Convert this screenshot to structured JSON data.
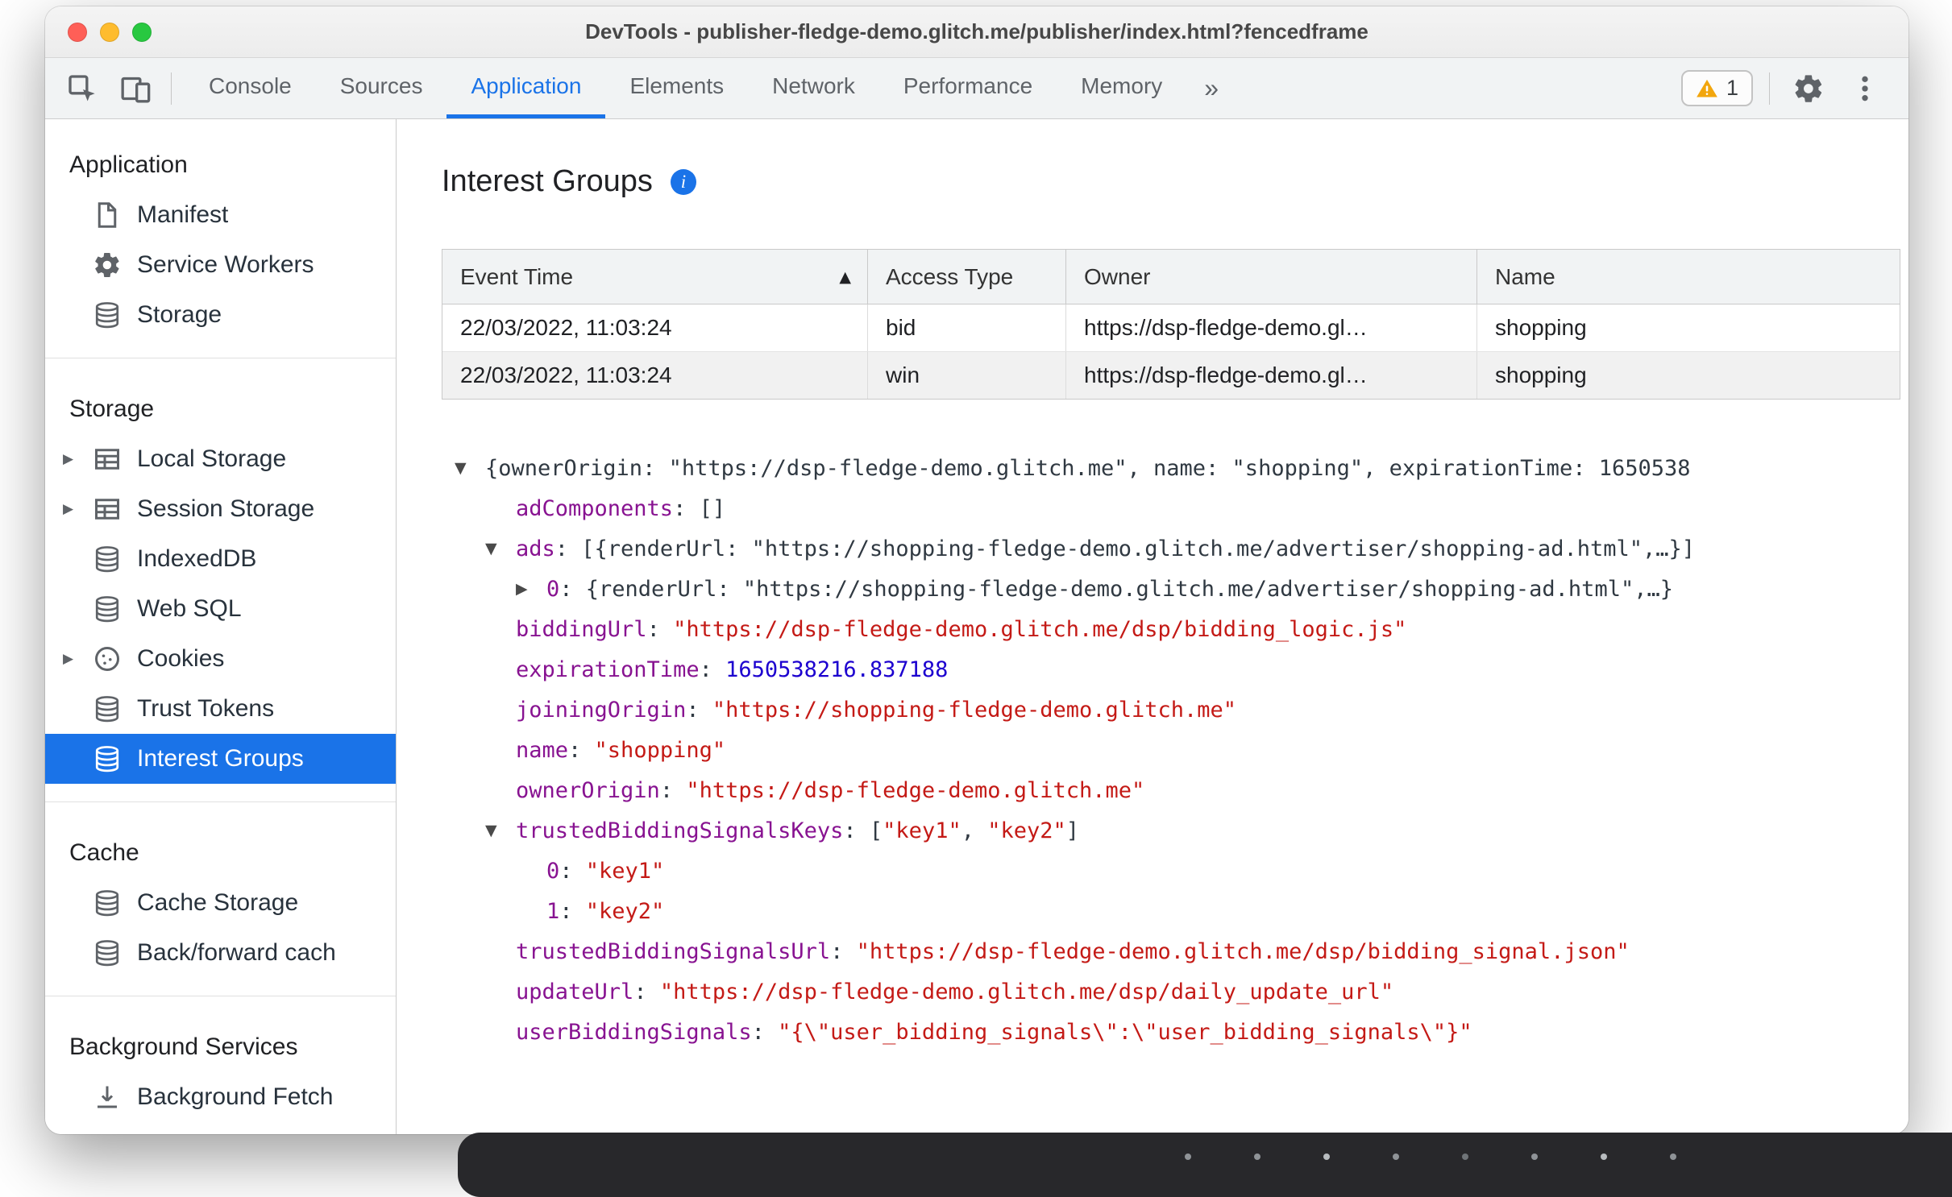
{
  "window": {
    "title": "DevTools - publisher-fledge-demo.glitch.me/publisher/index.html?fencedframe"
  },
  "toolbar": {
    "tabs": [
      {
        "label": "Console"
      },
      {
        "label": "Sources"
      },
      {
        "label": "Application",
        "selected": true
      },
      {
        "label": "Elements"
      },
      {
        "label": "Network"
      },
      {
        "label": "Performance"
      },
      {
        "label": "Memory"
      }
    ],
    "more_tabs_label": "»",
    "warning_count": "1"
  },
  "sidebar": {
    "sections": [
      {
        "title": "Application",
        "items": [
          {
            "label": "Manifest",
            "icon": "manifest-icon"
          },
          {
            "label": "Service Workers",
            "icon": "gear-icon"
          },
          {
            "label": "Storage",
            "icon": "database-icon"
          }
        ]
      },
      {
        "title": "Storage",
        "items": [
          {
            "label": "Local Storage",
            "icon": "table-icon",
            "expander": true
          },
          {
            "label": "Session Storage",
            "icon": "table-icon",
            "expander": true
          },
          {
            "label": "IndexedDB",
            "icon": "database-icon"
          },
          {
            "label": "Web SQL",
            "icon": "database-icon"
          },
          {
            "label": "Cookies",
            "icon": "cookie-icon",
            "expander": true
          },
          {
            "label": "Trust Tokens",
            "icon": "database-icon"
          },
          {
            "label": "Interest Groups",
            "icon": "database-icon",
            "selected": true
          }
        ]
      },
      {
        "title": "Cache",
        "items": [
          {
            "label": "Cache Storage",
            "icon": "database-icon"
          },
          {
            "label": "Back/forward cach",
            "icon": "database-icon"
          }
        ]
      },
      {
        "title": "Background Services",
        "items": [
          {
            "label": "Background Fetch",
            "icon": "fetch-icon"
          }
        ]
      }
    ]
  },
  "main": {
    "heading": "Interest Groups",
    "info_glyph": "i",
    "table": {
      "columns": [
        "Event Time",
        "Access Type",
        "Owner",
        "Name"
      ],
      "sort": {
        "column": "Event Time",
        "direction": "ascending"
      },
      "rows": [
        [
          "22/03/2022, 11:03:24",
          "bid",
          "https://dsp-fledge-demo.gl…",
          "shopping"
        ],
        [
          "22/03/2022, 11:03:24",
          "win",
          "https://dsp-fledge-demo.gl…",
          "shopping"
        ]
      ]
    },
    "tree": {
      "lines": [
        {
          "indent": 0,
          "arrow": "down",
          "segs": [
            {
              "t": "{ownerOrigin: \"https://dsp-fledge-demo.glitch.me\", name: \"shopping\", expirationTime: 1650538",
              "c": "plain"
            }
          ]
        },
        {
          "indent": 1,
          "arrow": "",
          "segs": [
            {
              "t": "adComponents",
              "c": "key"
            },
            {
              "t": ": []",
              "c": "plain"
            }
          ]
        },
        {
          "indent": 1,
          "arrow": "down",
          "segs": [
            {
              "t": "ads",
              "c": "key"
            },
            {
              "t": ": [{renderUrl: \"https://shopping-fledge-demo.glitch.me/advertiser/shopping-ad.html\",…}]",
              "c": "plain"
            }
          ]
        },
        {
          "indent": 2,
          "arrow": "right",
          "segs": [
            {
              "t": "0",
              "c": "key"
            },
            {
              "t": ": {renderUrl: \"https://shopping-fledge-demo.glitch.me/advertiser/shopping-ad.html\",…}",
              "c": "plain"
            }
          ]
        },
        {
          "indent": 1,
          "arrow": "",
          "segs": [
            {
              "t": "biddingUrl",
              "c": "key"
            },
            {
              "t": ": ",
              "c": "plain"
            },
            {
              "t": "\"https://dsp-fledge-demo.glitch.me/dsp/bidding_logic.js\"",
              "c": "str"
            }
          ]
        },
        {
          "indent": 1,
          "arrow": "",
          "segs": [
            {
              "t": "expirationTime",
              "c": "key"
            },
            {
              "t": ": ",
              "c": "plain"
            },
            {
              "t": "1650538216.837188",
              "c": "num"
            }
          ]
        },
        {
          "indent": 1,
          "arrow": "",
          "segs": [
            {
              "t": "joiningOrigin",
              "c": "key"
            },
            {
              "t": ": ",
              "c": "plain"
            },
            {
              "t": "\"https://shopping-fledge-demo.glitch.me\"",
              "c": "str"
            }
          ]
        },
        {
          "indent": 1,
          "arrow": "",
          "segs": [
            {
              "t": "name",
              "c": "key"
            },
            {
              "t": ": ",
              "c": "plain"
            },
            {
              "t": "\"shopping\"",
              "c": "str"
            }
          ]
        },
        {
          "indent": 1,
          "arrow": "",
          "segs": [
            {
              "t": "ownerOrigin",
              "c": "key"
            },
            {
              "t": ": ",
              "c": "plain"
            },
            {
              "t": "\"https://dsp-fledge-demo.glitch.me\"",
              "c": "str"
            }
          ]
        },
        {
          "indent": 1,
          "arrow": "down",
          "segs": [
            {
              "t": "trustedBiddingSignalsKeys",
              "c": "key"
            },
            {
              "t": ": [",
              "c": "plain"
            },
            {
              "t": "\"key1\"",
              "c": "str"
            },
            {
              "t": ", ",
              "c": "plain"
            },
            {
              "t": "\"key2\"",
              "c": "str"
            },
            {
              "t": "]",
              "c": "plain"
            }
          ]
        },
        {
          "indent": 2,
          "arrow": "",
          "segs": [
            {
              "t": "0",
              "c": "key"
            },
            {
              "t": ": ",
              "c": "plain"
            },
            {
              "t": "\"key1\"",
              "c": "str"
            }
          ]
        },
        {
          "indent": 2,
          "arrow": "",
          "segs": [
            {
              "t": "1",
              "c": "key"
            },
            {
              "t": ": ",
              "c": "plain"
            },
            {
              "t": "\"key2\"",
              "c": "str"
            }
          ]
        },
        {
          "indent": 1,
          "arrow": "",
          "segs": [
            {
              "t": "trustedBiddingSignalsUrl",
              "c": "key"
            },
            {
              "t": ": ",
              "c": "plain"
            },
            {
              "t": "\"https://dsp-fledge-demo.glitch.me/dsp/bidding_signal.json\"",
              "c": "str"
            }
          ]
        },
        {
          "indent": 1,
          "arrow": "",
          "segs": [
            {
              "t": "updateUrl",
              "c": "key"
            },
            {
              "t": ": ",
              "c": "plain"
            },
            {
              "t": "\"https://dsp-fledge-demo.glitch.me/dsp/daily_update_url\"",
              "c": "str"
            }
          ]
        },
        {
          "indent": 1,
          "arrow": "",
          "segs": [
            {
              "t": "userBiddingSignals",
              "c": "key"
            },
            {
              "t": ": ",
              "c": "plain"
            },
            {
              "t": "\"{\\\"user_bidding_signals\\\":\\\"user_bidding_signals\\\"}\"",
              "c": "str"
            }
          ]
        }
      ]
    }
  },
  "colors": {
    "accent_blue": "#1a73e8",
    "json_key": "#881391",
    "json_string": "#c41a16",
    "json_number": "#1c00cf",
    "warning_yellow": "#f2a60d"
  }
}
